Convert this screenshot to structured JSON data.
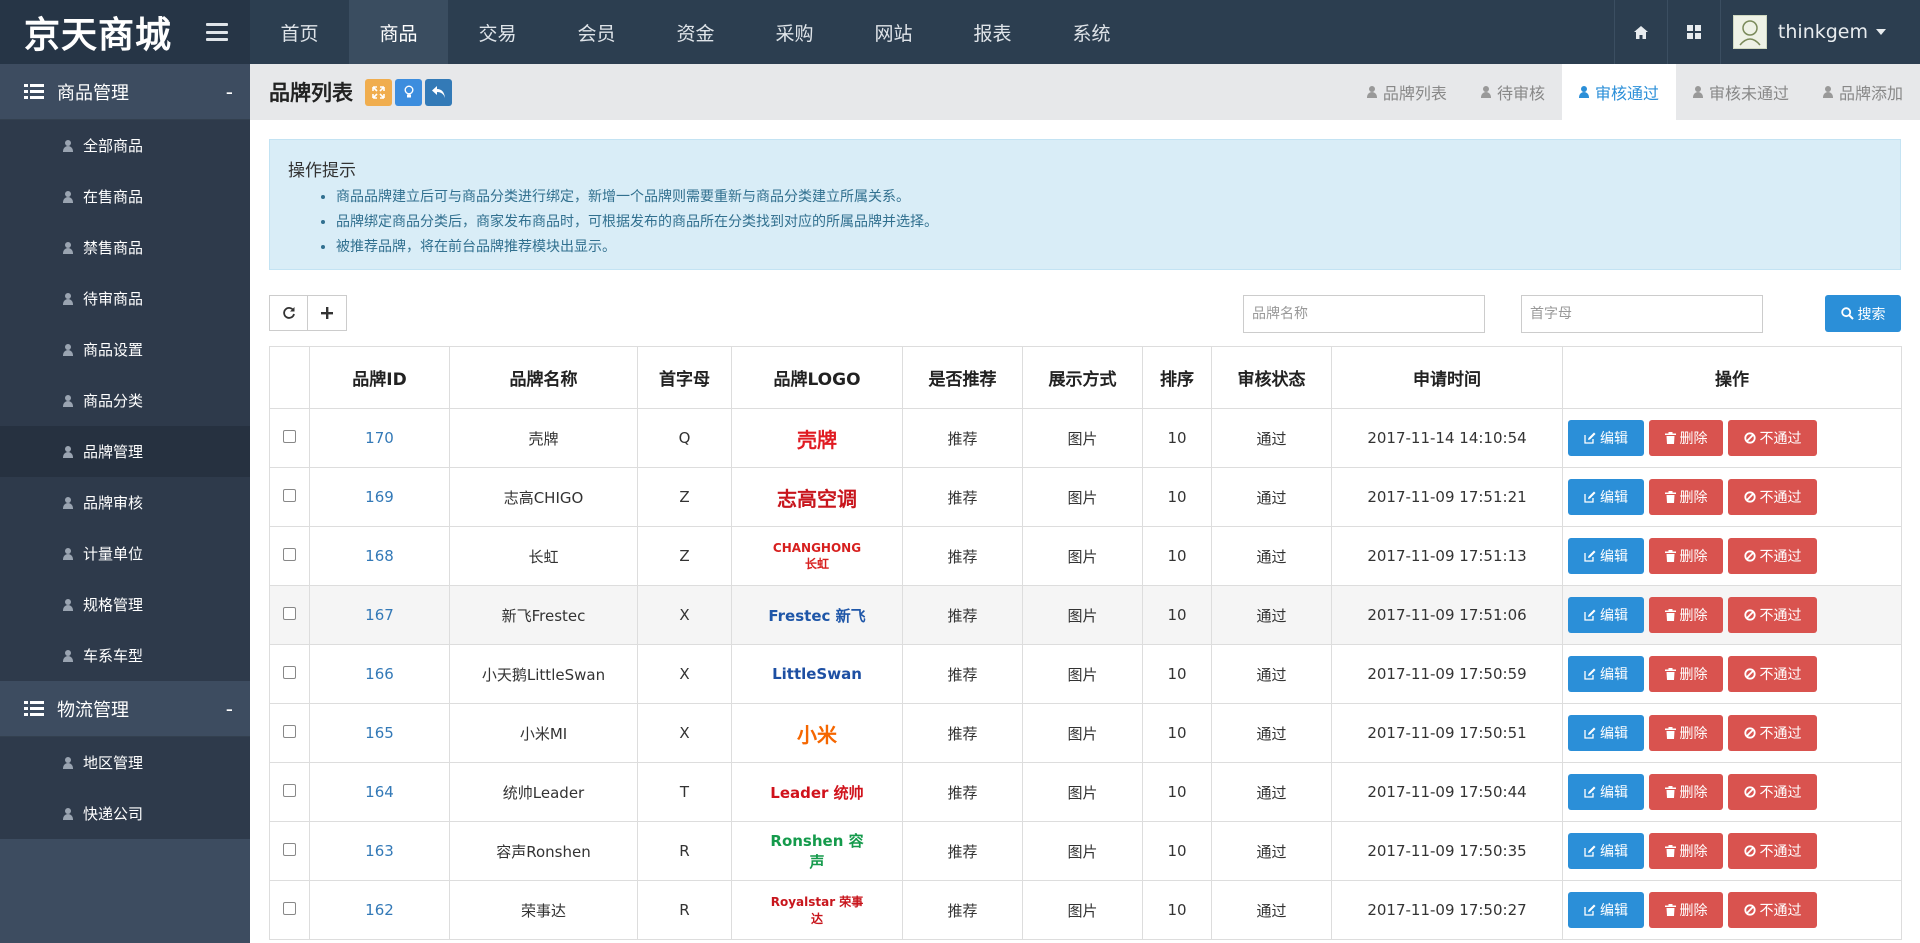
{
  "brand": {
    "logo_text": "京天商城"
  },
  "topnav": [
    {
      "label": "首页",
      "active": false
    },
    {
      "label": "商品",
      "active": true
    },
    {
      "label": "交易",
      "active": false
    },
    {
      "label": "会员",
      "active": false
    },
    {
      "label": "资金",
      "active": false
    },
    {
      "label": "采购",
      "active": false
    },
    {
      "label": "网站",
      "active": false
    },
    {
      "label": "报表",
      "active": false
    },
    {
      "label": "系统",
      "active": false
    }
  ],
  "user": {
    "name": "thinkgem"
  },
  "sidebar": {
    "group1": {
      "title": "商品管理",
      "toggle": "-",
      "items": [
        "全部商品",
        "在售商品",
        "禁售商品",
        "待审商品",
        "商品设置",
        "商品分类",
        "品牌管理",
        "品牌审核",
        "计量单位",
        "规格管理",
        "车系车型"
      ],
      "active_index": 6
    },
    "group2": {
      "title": "物流管理",
      "toggle": "-",
      "items": [
        "地区管理",
        "快递公司"
      ]
    }
  },
  "page": {
    "title": "品牌列表",
    "tabs": [
      "品牌列表",
      "待审核",
      "审核通过",
      "审核未通过",
      "品牌添加"
    ],
    "active_tab": 2
  },
  "tips": {
    "title": "操作提示",
    "items": [
      "商品品牌建立后可与商品分类进行绑定，新增一个品牌则需要重新与商品分类建立所属关系。",
      "品牌绑定商品分类后，商家发布商品时，可根据发布的商品所在分类找到对应的所属品牌并选择。",
      "被推荐品牌，将在前台品牌推荐模块出显示。"
    ]
  },
  "search": {
    "name_placeholder": "品牌名称",
    "initial_placeholder": "首字母",
    "button_label": "搜索"
  },
  "table": {
    "headers": [
      "品牌ID",
      "品牌名称",
      "首字母",
      "品牌LOGO",
      "是否推荐",
      "展示方式",
      "排序",
      "审核状态",
      "申请时间",
      "操作"
    ],
    "actions": {
      "edit": "编辑",
      "delete": "删除",
      "reject": "不通过"
    },
    "rows": [
      {
        "id": "170",
        "name": "壳牌",
        "initial": "Q",
        "logo_text": "壳牌",
        "logo_color": "#e01b22",
        "recommend": "推荐",
        "display": "图片",
        "sort": "10",
        "status": "通过",
        "time": "2017-11-14 14:10:54"
      },
      {
        "id": "169",
        "name": "志高CHIGO",
        "initial": "Z",
        "logo_text": "志高空调",
        "logo_color": "#c8161d",
        "recommend": "推荐",
        "display": "图片",
        "sort": "10",
        "status": "通过",
        "time": "2017-11-09 17:51:21"
      },
      {
        "id": "168",
        "name": "长虹",
        "initial": "Z",
        "logo_text": "CHANGHONG 长虹",
        "logo_color": "#d7201f",
        "recommend": "推荐",
        "display": "图片",
        "sort": "10",
        "status": "通过",
        "time": "2017-11-09 17:51:13"
      },
      {
        "id": "167",
        "name": "新飞Frestec",
        "initial": "X",
        "logo_text": "Frestec 新飞",
        "logo_color": "#1e56a8",
        "recommend": "推荐",
        "display": "图片",
        "sort": "10",
        "status": "通过",
        "time": "2017-11-09 17:51:06"
      },
      {
        "id": "166",
        "name": "小天鹅LittleSwan",
        "initial": "X",
        "logo_text": "LittleSwan",
        "logo_color": "#1d4fa3",
        "recommend": "推荐",
        "display": "图片",
        "sort": "10",
        "status": "通过",
        "time": "2017-11-09 17:50:59"
      },
      {
        "id": "165",
        "name": "小米MI",
        "initial": "X",
        "logo_text": "小米",
        "logo_color": "#f56600",
        "recommend": "推荐",
        "display": "图片",
        "sort": "10",
        "status": "通过",
        "time": "2017-11-09 17:50:51"
      },
      {
        "id": "164",
        "name": "统帅Leader",
        "initial": "T",
        "logo_text": "Leader 统帅",
        "logo_color": "#d0121b",
        "recommend": "推荐",
        "display": "图片",
        "sort": "10",
        "status": "通过",
        "time": "2017-11-09 17:50:44"
      },
      {
        "id": "163",
        "name": "容声Ronshen",
        "initial": "R",
        "logo_text": "Ronshen 容声",
        "logo_color": "#149a4b",
        "recommend": "推荐",
        "display": "图片",
        "sort": "10",
        "status": "通过",
        "time": "2017-11-09 17:50:35"
      },
      {
        "id": "162",
        "name": "荣事达",
        "initial": "R",
        "logo_text": "Royalstar 荣事达",
        "logo_color": "#c8161d",
        "recommend": "推荐",
        "display": "图片",
        "sort": "10",
        "status": "通过",
        "time": "2017-11-09 17:50:27"
      }
    ]
  }
}
